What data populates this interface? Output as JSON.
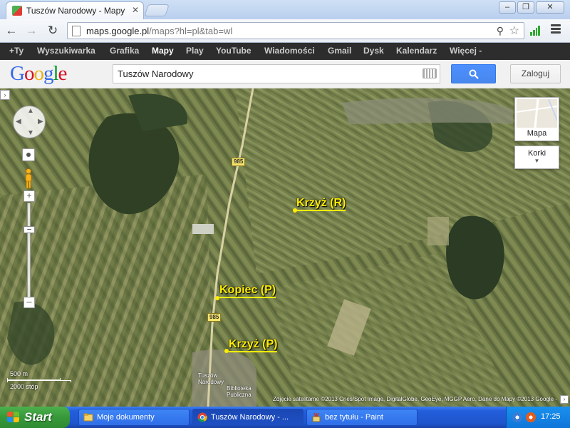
{
  "browser": {
    "tab_title": "Tuszów Narodowy - Mapy Go",
    "url_host": "maps.google.pl",
    "url_rest": "/maps?hl=pl&tab=wl"
  },
  "gbar": {
    "items": [
      "+Ty",
      "Wyszukiwarka",
      "Grafika",
      "Mapy",
      "Play",
      "YouTube",
      "Wiadomości",
      "Gmail",
      "Dysk",
      "Kalendarz",
      "Więcej -"
    ],
    "active": "Mapy"
  },
  "header": {
    "logo_letters": [
      "G",
      "o",
      "o",
      "g",
      "l",
      "e"
    ],
    "logo_colors": [
      "#3369e8",
      "#d50f25",
      "#eeb211",
      "#3369e8",
      "#009925",
      "#d50f25"
    ],
    "search_value": "Tuszów Narodowy",
    "login_label": "Zaloguj"
  },
  "map": {
    "maptype_label": "Mapa",
    "overlay_label": "Korki",
    "markers": [
      {
        "label": "Krzyż (R)"
      },
      {
        "label": "Kopiec (P)"
      },
      {
        "label": "Krzyż (P)"
      }
    ],
    "road_number": "985",
    "town_label_1": "Tuszów",
    "town_label_2": "Narodowy",
    "library_label_1": "Biblioteka",
    "library_label_2": "Publiczna",
    "scale_metric": "500 m",
    "scale_imperial": "2000 stóp",
    "attribution": "Zdjęcie satelitarne ©2013 Cnes/Spot Image, DigitalGlobe, GeoEye, MGGP Aero, Dane do Mapy ©2013 Google -"
  },
  "taskbar": {
    "start_label": "Start",
    "tasks": [
      {
        "label": "Moje dokumenty"
      },
      {
        "label": "Tuszów Narodowy - ..."
      },
      {
        "label": "bez tytułu - Paint"
      }
    ],
    "clock": "17:25"
  },
  "colors": {
    "search_button": "#4d90fe",
    "marker_yellow": "#ffee00",
    "taskbar_blue": "#245edb",
    "start_green": "#37983a"
  }
}
